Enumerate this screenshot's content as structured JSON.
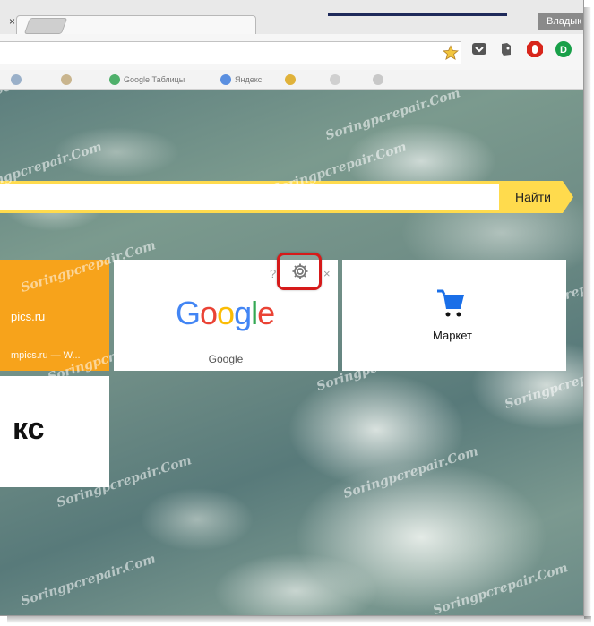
{
  "browser": {
    "user_name": "Владык",
    "tab_close_glyph": "×",
    "bookmarks": [
      "Google Таблицы",
      "Яндекс"
    ],
    "extensions": [
      "pocket-icon",
      "evernote-icon",
      "adblock-icon",
      "grammarly-icon"
    ]
  },
  "newtab": {
    "search": {
      "query": "",
      "button_label": "Найти"
    },
    "tiles": [
      {
        "id": "lumpics",
        "title": "pics.ru",
        "subtitle": "mpics.ru — W...",
        "color": "#f7a31b"
      },
      {
        "id": "google",
        "logo": "Google",
        "caption": "Google"
      },
      {
        "id": "market",
        "caption": "Маркет"
      },
      {
        "id": "yandex",
        "title": "кс"
      }
    ],
    "tile_actions": {
      "help": "?",
      "settings": "settings",
      "close": "×"
    }
  },
  "colors": {
    "search_accent": "#ffdb4d",
    "highlight_box": "#d61a1a",
    "google_blue": "#4285f4",
    "google_red": "#ea4335",
    "google_yellow": "#fbbc05",
    "google_green": "#34a853",
    "market_blue": "#1a6fe8"
  },
  "watermark": "Soringpcrepair.Com"
}
